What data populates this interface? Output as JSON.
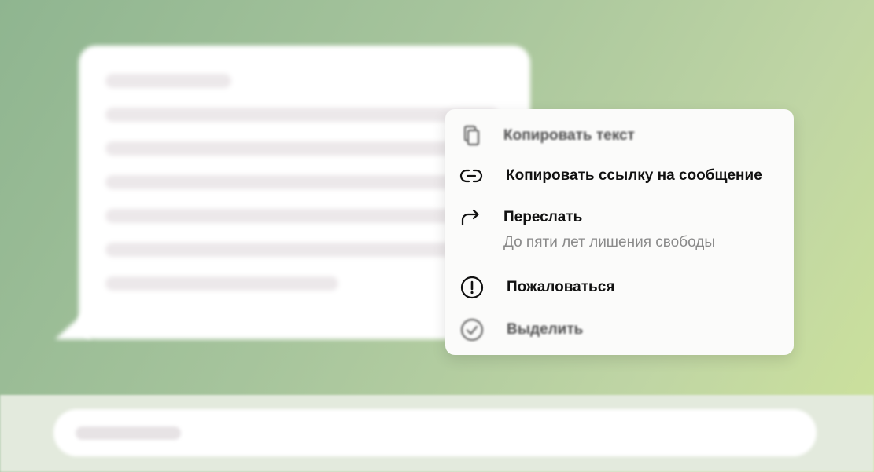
{
  "context_menu": {
    "items": [
      {
        "label": "Копировать текст",
        "icon": "copy-icon"
      },
      {
        "label": "Копировать ссылку на сообщение",
        "icon": "link-icon"
      },
      {
        "label": "Переслать",
        "sublabel": "До пяти лет лишения свободы",
        "icon": "forward-arrow-icon"
      },
      {
        "label": "Пожаловаться",
        "icon": "exclamation-circle-icon"
      },
      {
        "label": "Выделить",
        "icon": "check-circle-icon"
      }
    ]
  },
  "colors": {
    "background_start": "#8fb590",
    "background_end": "#cde29b",
    "menu_background": "#fbfbfa",
    "text_primary": "#111111",
    "text_secondary": "#8a8a8a"
  }
}
